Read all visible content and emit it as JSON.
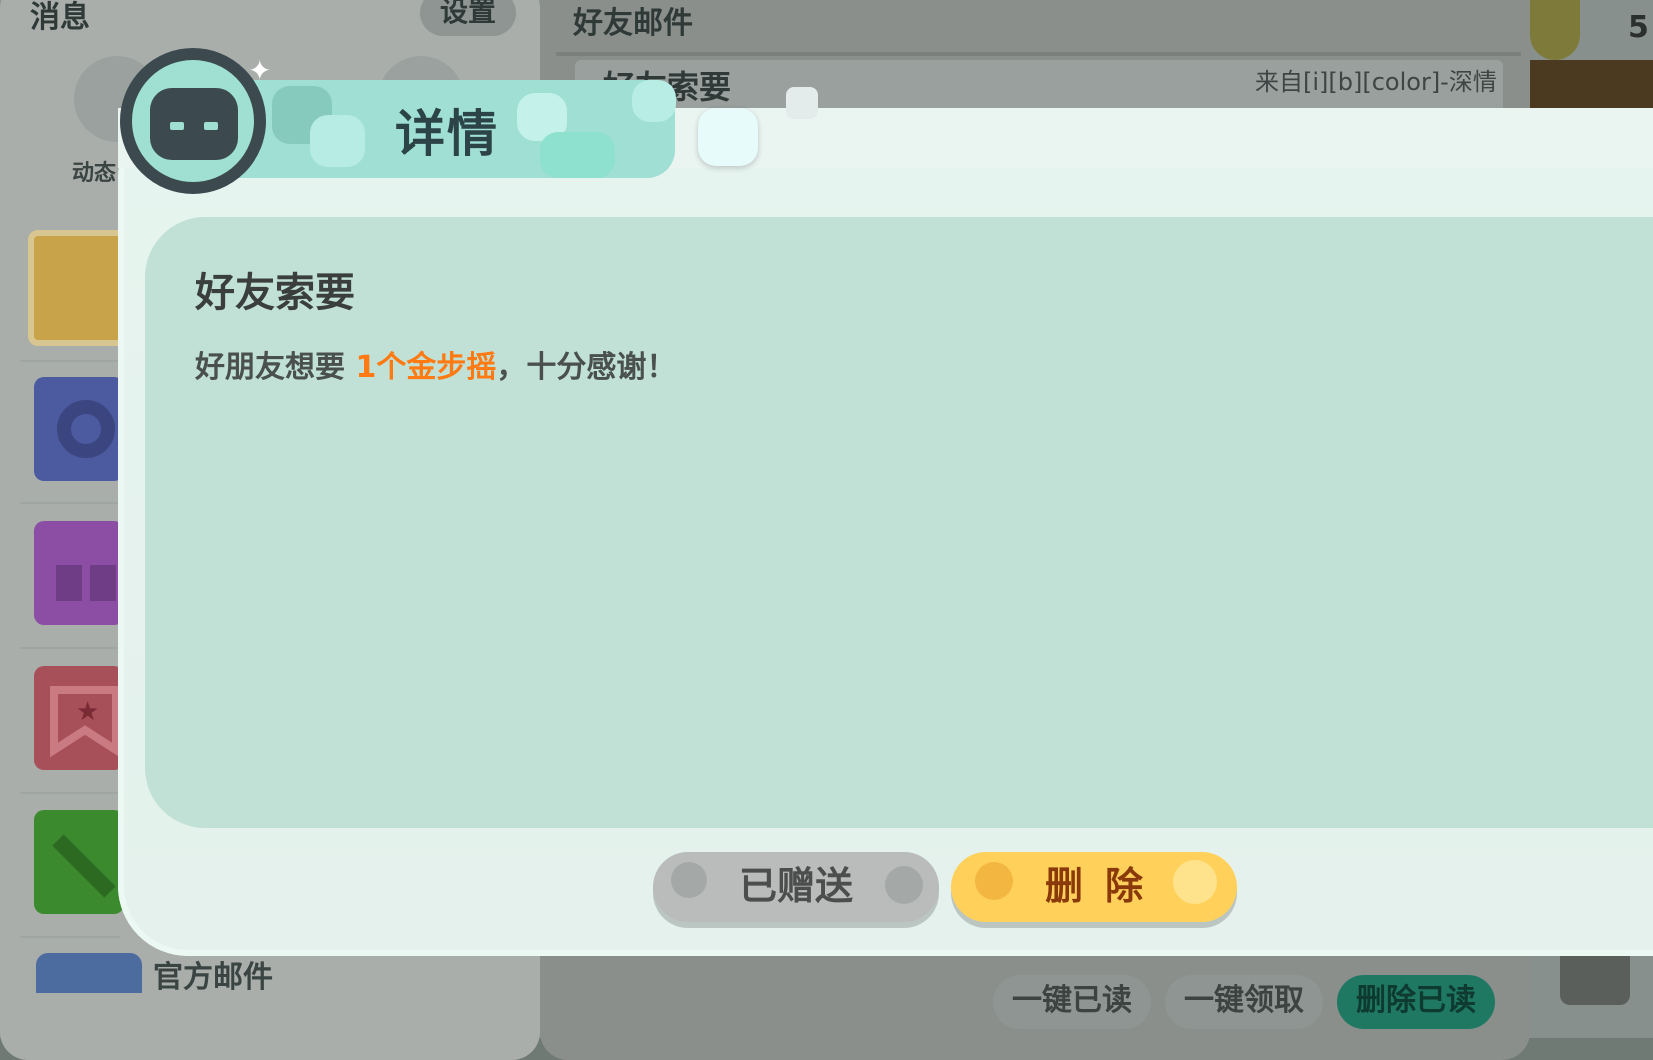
{
  "background": {
    "left_panel": {
      "title": "消息",
      "settings_label": "设置",
      "dynamic_tab_label": "动态",
      "official_mail_label": "官方邮件"
    },
    "right_panel": {
      "title": "好友邮件",
      "mail_row": {
        "title": "好友索要",
        "from": "来自[i][b][color]-深情"
      },
      "buttons": {
        "mark_all_read": "一键已读",
        "claim_all": "一键领取",
        "delete_read": "删除已读"
      },
      "coin_count": "5"
    }
  },
  "dialog": {
    "header_title": "详情",
    "mail_title": "好友索要",
    "body_prefix": "好朋友想要 ",
    "body_highlight": "1个金步摇",
    "body_suffix": "，十分感谢！",
    "highlight_color": "#ff7a12",
    "buttons": {
      "gifted": "已赠送",
      "delete": "删除"
    }
  },
  "colors": {
    "dialog_bg": "#e4f1ec",
    "content_bg": "#c1e1d6",
    "ribbon": "#9fdfd4",
    "delete_button": "#ffd15a",
    "gifted_button": "#b9bcbb",
    "teal_button": "#1e7862"
  },
  "icons": {
    "avatar": "character-avatar-icon",
    "settings": "gear-icon",
    "gift": "gift-icon",
    "bookmark": "bookmark-star-icon",
    "pencil": "pencil-icon",
    "friend_mail": "person-mail-icon"
  }
}
